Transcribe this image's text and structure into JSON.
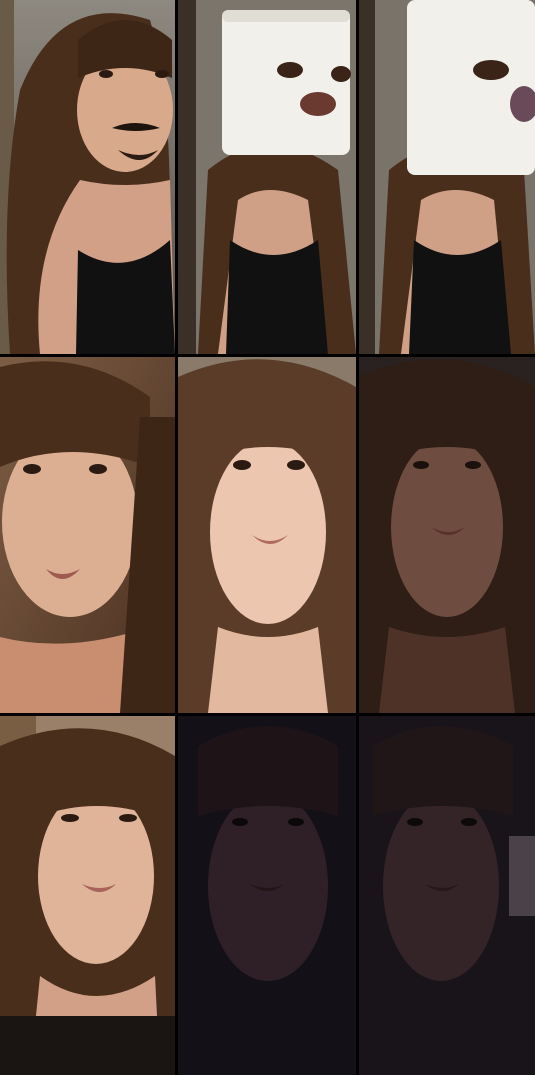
{
  "collage": {
    "rows": 3,
    "columns": 3,
    "tiles": [
      {
        "row": 1,
        "col": 1,
        "subject": "selfie-with-mustache-filter",
        "tone": "warm-light"
      },
      {
        "row": 1,
        "col": 2,
        "subject": "toilet-paper-roll-face-filter",
        "tone": "neutral"
      },
      {
        "row": 1,
        "col": 3,
        "subject": "toilet-paper-roll-face-filter",
        "tone": "neutral"
      },
      {
        "row": 2,
        "col": 1,
        "subject": "selfie-closeup",
        "tone": "warm"
      },
      {
        "row": 2,
        "col": 2,
        "subject": "selfie-closeup",
        "tone": "bright"
      },
      {
        "row": 2,
        "col": 3,
        "subject": "selfie-closeup",
        "tone": "dark"
      },
      {
        "row": 3,
        "col": 1,
        "subject": "selfie-closeup",
        "tone": "warm"
      },
      {
        "row": 3,
        "col": 2,
        "subject": "selfie-closeup",
        "tone": "very-dark"
      },
      {
        "row": 3,
        "col": 3,
        "subject": "selfie-closeup",
        "tone": "very-dark"
      }
    ]
  },
  "colors": {
    "background": "#000000",
    "hair": "#4a3020",
    "skin_light": "#e8c2a8",
    "skin_warm": "#d49a7c",
    "top": "#111111",
    "paper": "#f2f0ea"
  }
}
